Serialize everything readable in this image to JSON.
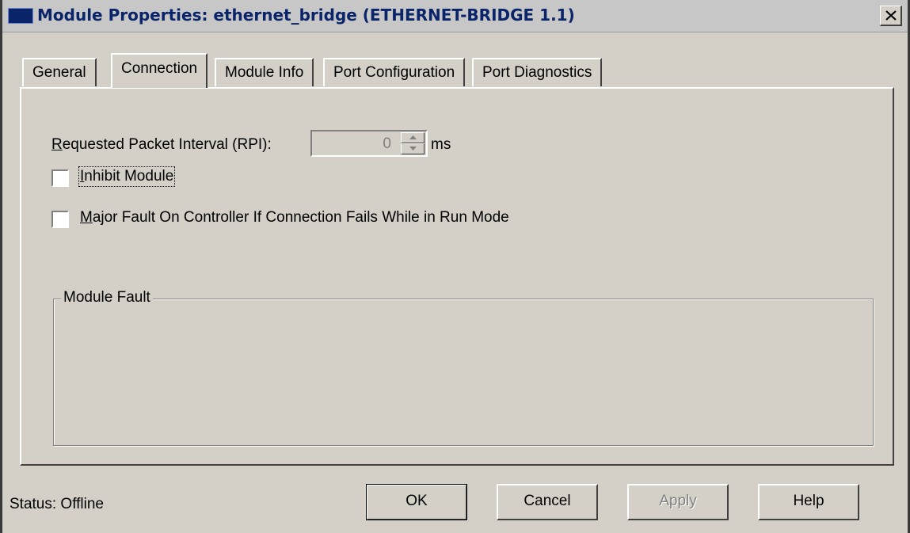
{
  "page": {
    "partial_text": "Module Properties dialog configuring the ethernet module"
  },
  "window": {
    "title": "Module Properties: ethernet_bridge (ETHERNET-BRIDGE 1.1)",
    "close_icon": "close-icon",
    "title_icon": "window-icon"
  },
  "tabs": [
    {
      "label": "General",
      "active": false
    },
    {
      "label": "Connection",
      "active": true
    },
    {
      "label": "Module Info",
      "active": false
    },
    {
      "label": "Port Configuration",
      "active": false
    },
    {
      "label": "Port Diagnostics",
      "active": false
    }
  ],
  "connection": {
    "rpi_label_prefix": "R",
    "rpi_label_rest": "equested Packet Interval (RPI):",
    "rpi_value": "0",
    "rpi_unit": "ms",
    "inhibit_prefix": "I",
    "inhibit_rest": "nhibit Module",
    "inhibit_checked": false,
    "major_fault_prefix": "M",
    "major_fault_rest": "ajor Fault On Controller If Connection Fails While in Run Mode",
    "major_fault_checked": false,
    "module_fault_legend": "Module Fault",
    "module_fault_text": ""
  },
  "footer": {
    "status": "Status:  Offline",
    "ok_label": "OK",
    "cancel_label": "Cancel",
    "apply_label": "Apply",
    "help_label": "Help"
  },
  "colors": {
    "dialog_face": "#d4d0c8",
    "title_text": "#0a246a",
    "disabled_text": "#808080"
  }
}
